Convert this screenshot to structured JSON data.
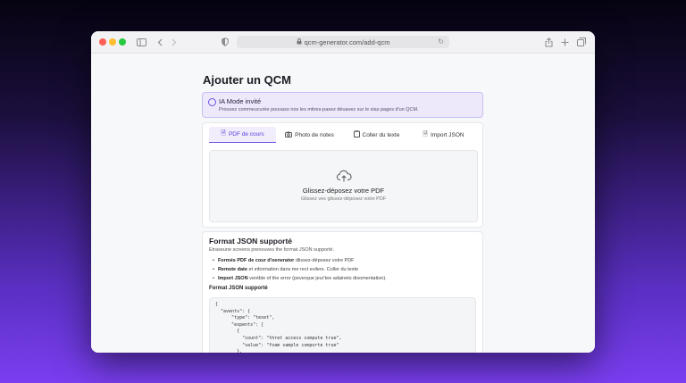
{
  "browser": {
    "url": "qcm-generator.com/add-qcm"
  },
  "page": {
    "title": "Ajouter un QCM"
  },
  "banner": {
    "title": "IA Mode invité",
    "text": "Prouvez commeucurée pouvaso nos les mitres-pasez déuavez sur le sias pages d'un QCM."
  },
  "tabs": [
    {
      "label": "PDF de cours",
      "icon": "file-icon"
    },
    {
      "label": "Photo de notes",
      "icon": "camera-icon"
    },
    {
      "label": "Coller du texte",
      "icon": "clipboard-icon"
    },
    {
      "label": "Import JSON",
      "icon": "file-code-icon"
    }
  ],
  "dropzone": {
    "title": "Glissez-déposez votre PDF",
    "subtitle": "Glissez ves glissez-déposez votre PDF"
  },
  "json_card": {
    "title": "Format JSON supporté",
    "description": "Etraseune screens prenouves the format JSON supporté.",
    "items": [
      {
        "bold": "Formés PDF de cour d'oenerator",
        "rest": " dlissez-déposez votre PDF"
      },
      {
        "bold": "Remote date",
        "rest": " et ιnformation dans me rect evilers. Coller du texte"
      },
      {
        "bold": "Import JSON",
        "rest": " veréble of the error (peverque jeur'tee adainets disomentation)."
      }
    ],
    "subtitle": "Format JSON supporté",
    "code": "{\n  \"avents\": {\n      \"type\": \"texet\",\n      \"expents\": [\n        {\n          \"count\": \"thret access compute true\",\n          \"value\": \"foam sample comporte true\"\n        },"
  },
  "colors": {
    "accent": "#6c4fe0",
    "banner_bg": "#ede9fb"
  }
}
